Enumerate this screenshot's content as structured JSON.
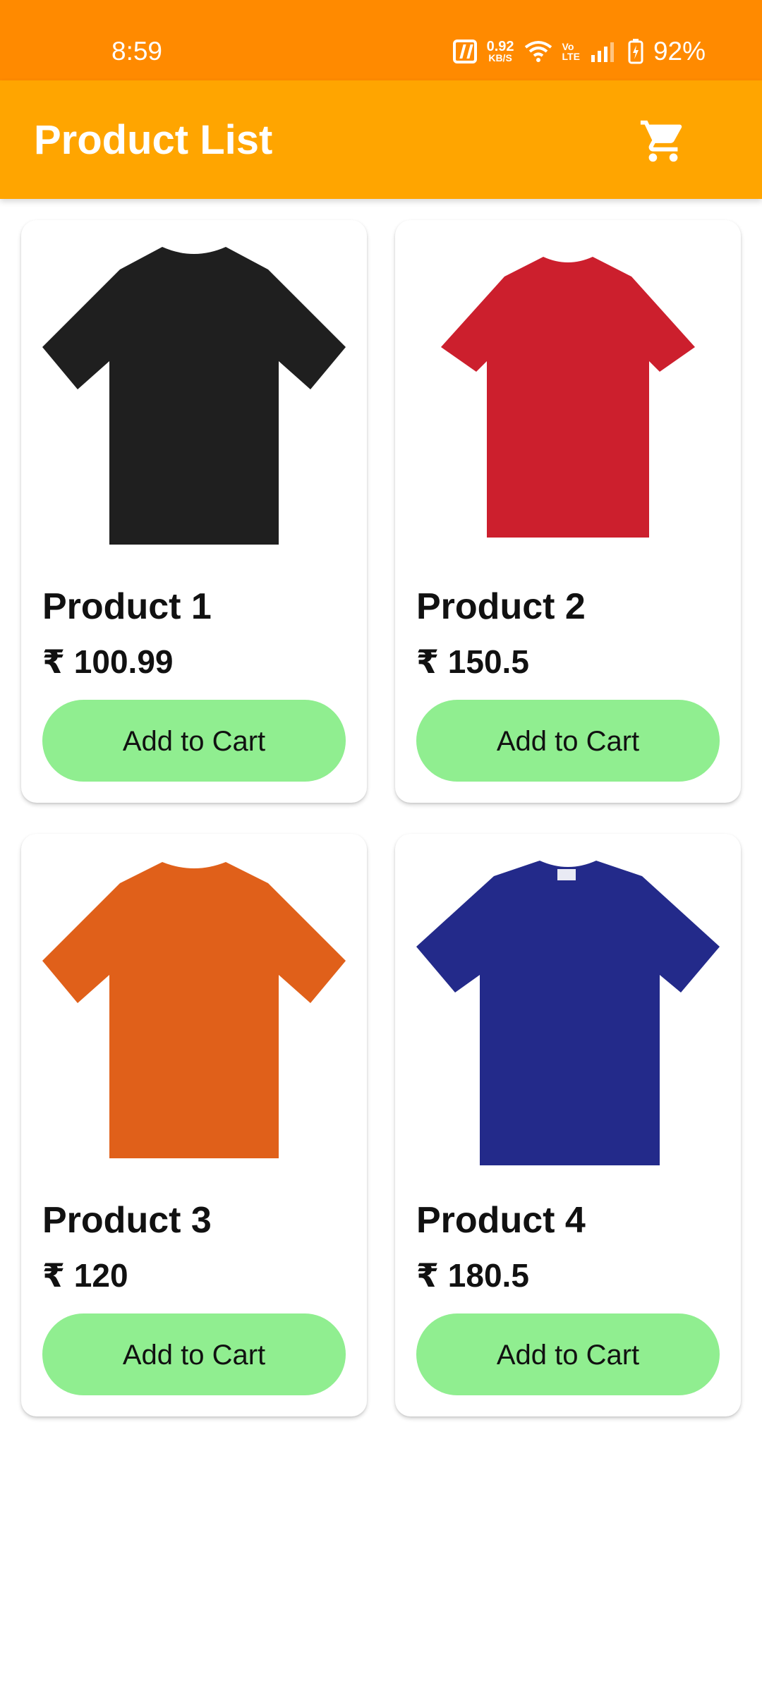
{
  "status_bar": {
    "time": "8:59",
    "speed_value": "0.92",
    "speed_unit": "KB/S",
    "volte_top": "Vo",
    "volte_bottom": "LTE",
    "battery": "92%"
  },
  "app_bar": {
    "title": "Product List",
    "cart_icon": "shopping-cart-icon"
  },
  "products": [
    {
      "name": "Product 1",
      "price": "₹ 100.99",
      "button": "Add to Cart",
      "color": "#1f1f1f",
      "image_icon": "black-tshirt"
    },
    {
      "name": "Product 2",
      "price": "₹ 150.5",
      "button": "Add to Cart",
      "color": "#cc1f2d",
      "image_icon": "red-tshirt"
    },
    {
      "name": "Product 3",
      "price": "₹ 120",
      "button": "Add to Cart",
      "color": "#e0601a",
      "image_icon": "orange-tshirt"
    },
    {
      "name": "Product 4",
      "price": "₹ 180.5",
      "button": "Add to Cart",
      "color": "#232a8a",
      "image_icon": "blue-tshirt"
    }
  ],
  "colors": {
    "status_bar": "#ff8a00",
    "app_bar": "#ffa500",
    "button": "#90ee90"
  }
}
